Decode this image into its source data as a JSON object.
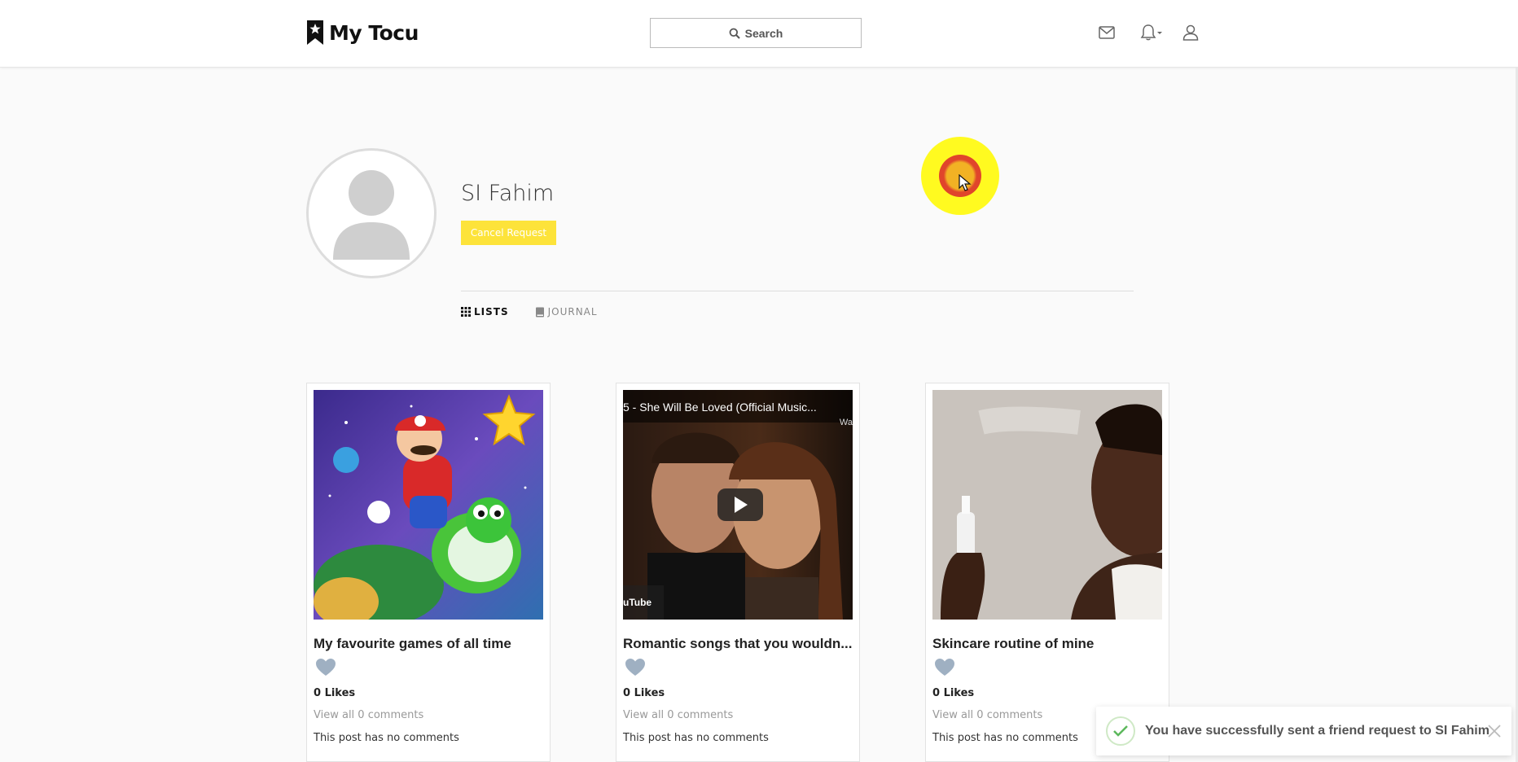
{
  "brand": {
    "name": "My Tocu"
  },
  "search": {
    "label": "Search"
  },
  "nav": {
    "icons": [
      "mail-icon",
      "bell-icon",
      "user-icon"
    ]
  },
  "profile": {
    "name": "SI Fahim",
    "cancel_label": "Cancel Request"
  },
  "tabs": [
    {
      "label": "LISTS",
      "icon": "grid-icon",
      "active": true
    },
    {
      "label": "JOURNAL",
      "icon": "book-icon",
      "active": false
    }
  ],
  "cards": [
    {
      "title": "My favourite games of all time",
      "likes": "0 Likes",
      "view_comments": "View all 0 comments",
      "no_comments": "This post has no comments"
    },
    {
      "title": "Romantic songs that you wouldn...",
      "video_title": "5 - She Will Be Loved (Official Music...",
      "video_corner": "Wa",
      "video_brand": "uTube",
      "likes": "0 Likes",
      "view_comments": "View all 0 comments",
      "no_comments": "This post has no comments"
    },
    {
      "title": "Skincare routine of mine",
      "likes": "0 Likes",
      "view_comments": "View all 0 comments",
      "no_comments": "This post has no comments"
    }
  ],
  "toast": {
    "message": "You have successfully sent a friend request to SI Fahim"
  },
  "colors": {
    "accent": "#fde33a",
    "heart": "#9fb0c2",
    "success": "#5cb85c"
  }
}
